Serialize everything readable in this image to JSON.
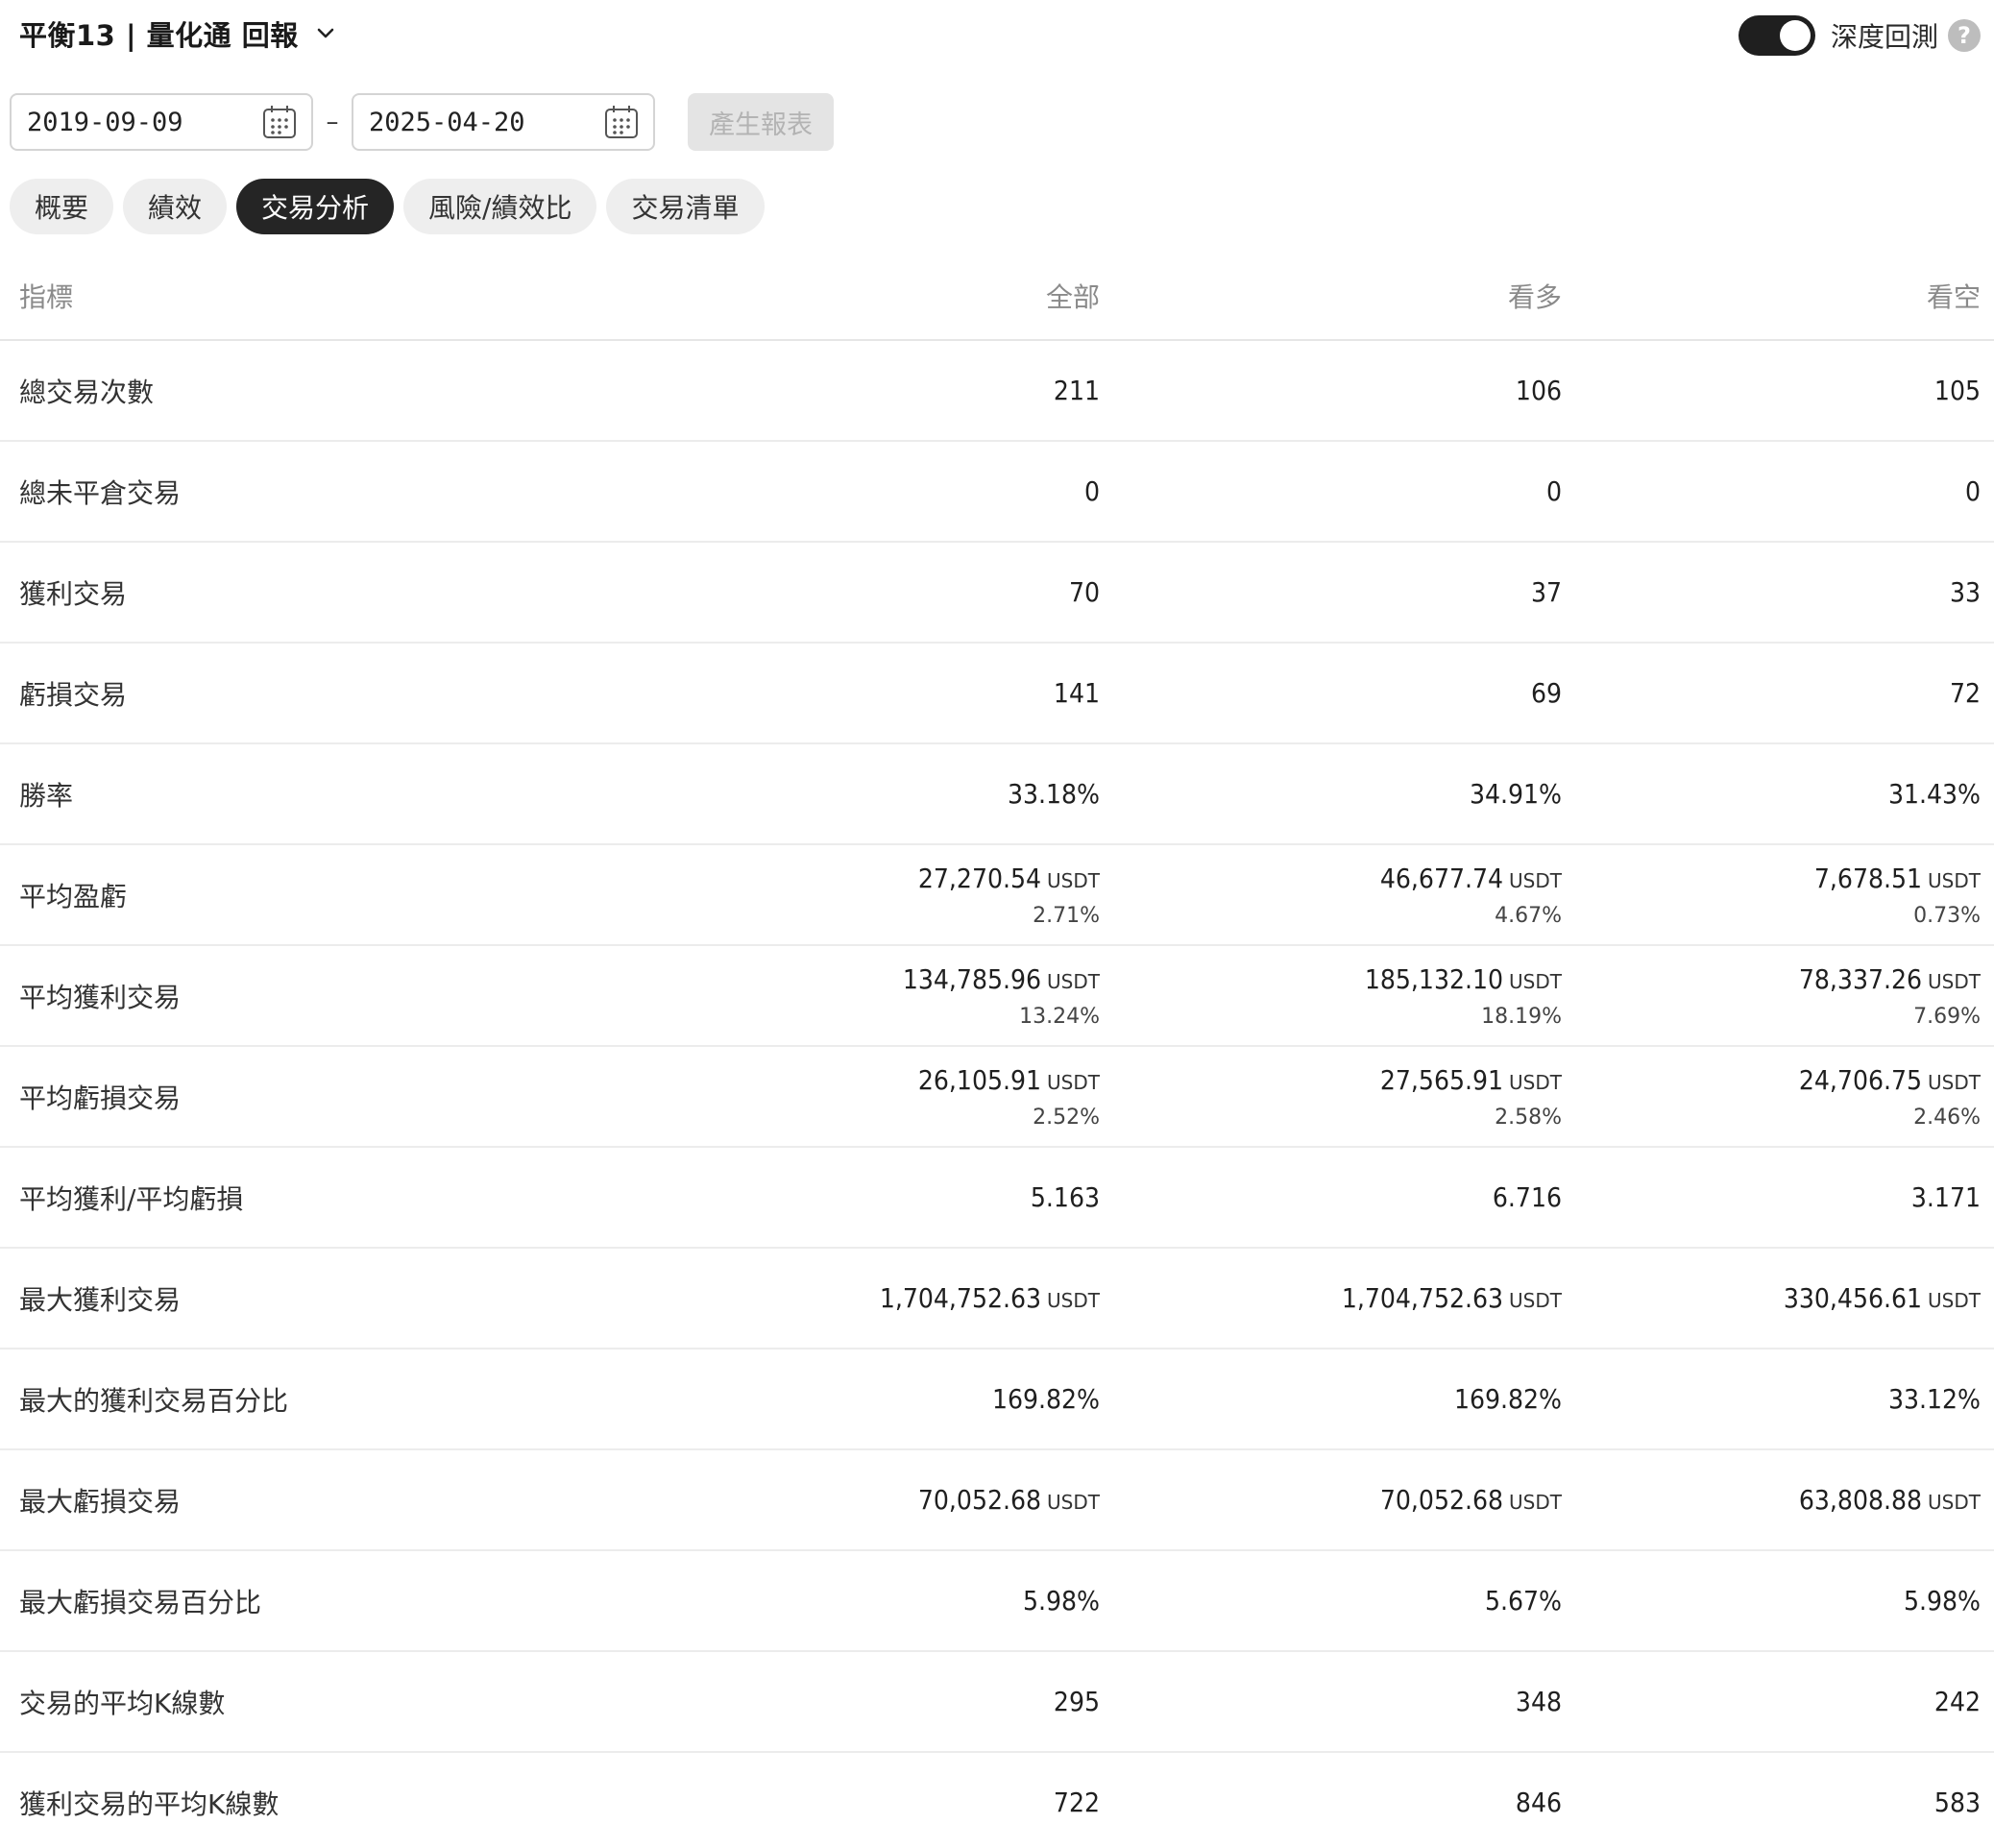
{
  "header": {
    "title": "平衡13 | 量化通 回報",
    "toggle_label": "深度回測",
    "help": "?"
  },
  "datebar": {
    "start_date": "2019-09-09",
    "separator": "–",
    "end_date": "2025-04-20",
    "generate_label": "產生報表"
  },
  "tabs": [
    {
      "label": "概要",
      "active": false
    },
    {
      "label": "績效",
      "active": false
    },
    {
      "label": "交易分析",
      "active": true
    },
    {
      "label": "風險/績效比",
      "active": false
    },
    {
      "label": "交易清單",
      "active": false
    }
  ],
  "table": {
    "columns": [
      "指標",
      "全部",
      "看多",
      "看空"
    ],
    "unit": "USDT",
    "rows": [
      {
        "label": "總交易次數",
        "all": {
          "value": "211"
        },
        "long": {
          "value": "106"
        },
        "short": {
          "value": "105"
        }
      },
      {
        "label": "總未平倉交易",
        "all": {
          "value": "0"
        },
        "long": {
          "value": "0"
        },
        "short": {
          "value": "0"
        }
      },
      {
        "label": "獲利交易",
        "all": {
          "value": "70"
        },
        "long": {
          "value": "37"
        },
        "short": {
          "value": "33"
        }
      },
      {
        "label": "虧損交易",
        "all": {
          "value": "141"
        },
        "long": {
          "value": "69"
        },
        "short": {
          "value": "72"
        }
      },
      {
        "label": "勝率",
        "all": {
          "value": "33.18%"
        },
        "long": {
          "value": "34.91%"
        },
        "short": {
          "value": "31.43%"
        }
      },
      {
        "label": "平均盈虧",
        "all": {
          "value": "27,270.54",
          "unit": "USDT",
          "sub": "2.71%"
        },
        "long": {
          "value": "46,677.74",
          "unit": "USDT",
          "sub": "4.67%"
        },
        "short": {
          "value": "7,678.51",
          "unit": "USDT",
          "sub": "0.73%"
        }
      },
      {
        "label": "平均獲利交易",
        "all": {
          "value": "134,785.96",
          "unit": "USDT",
          "sub": "13.24%"
        },
        "long": {
          "value": "185,132.10",
          "unit": "USDT",
          "sub": "18.19%"
        },
        "short": {
          "value": "78,337.26",
          "unit": "USDT",
          "sub": "7.69%"
        }
      },
      {
        "label": "平均虧損交易",
        "all": {
          "value": "26,105.91",
          "unit": "USDT",
          "sub": "2.52%"
        },
        "long": {
          "value": "27,565.91",
          "unit": "USDT",
          "sub": "2.58%"
        },
        "short": {
          "value": "24,706.75",
          "unit": "USDT",
          "sub": "2.46%"
        }
      },
      {
        "label": "平均獲利/平均虧損",
        "all": {
          "value": "5.163"
        },
        "long": {
          "value": "6.716"
        },
        "short": {
          "value": "3.171"
        }
      },
      {
        "label": "最大獲利交易",
        "all": {
          "value": "1,704,752.63",
          "unit": "USDT"
        },
        "long": {
          "value": "1,704,752.63",
          "unit": "USDT"
        },
        "short": {
          "value": "330,456.61",
          "unit": "USDT"
        }
      },
      {
        "label": "最大的獲利交易百分比",
        "all": {
          "value": "169.82%"
        },
        "long": {
          "value": "169.82%"
        },
        "short": {
          "value": "33.12%"
        }
      },
      {
        "label": "最大虧損交易",
        "all": {
          "value": "70,052.68",
          "unit": "USDT"
        },
        "long": {
          "value": "70,052.68",
          "unit": "USDT"
        },
        "short": {
          "value": "63,808.88",
          "unit": "USDT"
        }
      },
      {
        "label": "最大虧損交易百分比",
        "all": {
          "value": "5.98%"
        },
        "long": {
          "value": "5.67%"
        },
        "short": {
          "value": "5.98%"
        }
      },
      {
        "label": "交易的平均K線數",
        "all": {
          "value": "295"
        },
        "long": {
          "value": "348"
        },
        "short": {
          "value": "242"
        }
      },
      {
        "label": "獲利交易的平均K線數",
        "all": {
          "value": "722"
        },
        "long": {
          "value": "846"
        },
        "short": {
          "value": "583"
        }
      }
    ]
  }
}
